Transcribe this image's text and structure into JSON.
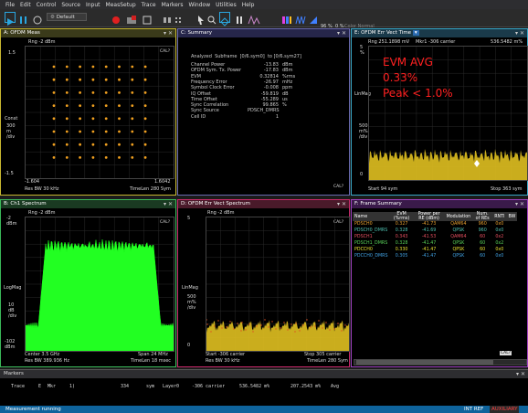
{
  "menu": [
    "File",
    "Edit",
    "Control",
    "Source",
    "Input",
    "MeasSetup",
    "Trace",
    "Markers",
    "Window",
    "Utilities",
    "Help"
  ],
  "toolbar": {
    "mode": "Default",
    "opacity": "96 %",
    "opacity_zero": "0 %",
    "color_mode": "Color Normal"
  },
  "panel_a": {
    "title": "A: OFDM Meas",
    "ref": "Rng -2 dBm",
    "cal": "CAL?",
    "y_top": "1.5",
    "y_mid": "Const",
    "y_scale": [
      "300",
      "m",
      "/div"
    ],
    "y_bottom": "-1.5",
    "x_left": "-1.604",
    "x_right": "1.6042",
    "footer_left": "Res BW 30 kHz",
    "footer_right": "TimeLen 280  Sym"
  },
  "panel_b": {
    "title": "B: Ch1 Spectrum",
    "ref": "Rng -2 dBm",
    "cal": "CAL?",
    "y_top": [
      "-2",
      "dBm"
    ],
    "y_mid": "LogMag",
    "y_scale": [
      "10",
      "dB",
      "/div"
    ],
    "y_bottom": [
      "-102",
      "dBm"
    ],
    "footer_left1": "Center 3.5 GHz",
    "footer_right1": "Span 24 MHz",
    "footer_left2": "Res BW 389.936 Hz",
    "footer_right2": "TimeLen 18 msec"
  },
  "panel_c": {
    "title": "C: Summary",
    "cal": "CAL?",
    "header": [
      "Analyzed",
      "Subframe",
      "[0/6.sym0]",
      "to",
      "[0/6.sym27]"
    ],
    "rows": [
      {
        "label": "Channel  Power",
        "value": "-13.83",
        "unit": "dBm"
      },
      {
        "label": "OFDM Sym. Tx. Power",
        "value": "-17.83",
        "unit": "dBm"
      },
      {
        "label": "EVM",
        "value": "0.32814",
        "unit": "%rms"
      },
      {
        "label": "Frequency  Error",
        "value": "-26.97",
        "unit": "mHz"
      },
      {
        "label": "Symbol  Clock  Error",
        "value": "-0.008",
        "unit": "ppm"
      },
      {
        "label": "IQ  Offset",
        "value": "-59.819",
        "unit": "dB"
      },
      {
        "label": "Time  Offset",
        "value": "-55.289",
        "unit": "us"
      },
      {
        "label": "Sync  Correlation",
        "value": "99.865",
        "unit": "%"
      },
      {
        "label": "Sync  Source",
        "value": "PDSCH_DMRS",
        "unit": ""
      },
      {
        "label": "Cell  ID",
        "value": "1",
        "unit": ""
      }
    ]
  },
  "panel_d": {
    "title": "D: OFDM Err Vect Spectrum",
    "ref": "Rng -2 dBm",
    "cal": "CAL?",
    "y_top": "5",
    "y_mid": "LinMag",
    "y_scale": [
      "500",
      "m%",
      "/div"
    ],
    "y_bottom": "0",
    "footer_left1": "Start -306  carrier",
    "footer_right1": "Stop 305  carrier",
    "footer_left2": "Res BW 30 kHz",
    "footer_right2": "TimeLen 280  Sym"
  },
  "panel_e": {
    "title": "E: OFDM Err Vect Time",
    "ref": "Rng 251.1898 mV",
    "marker": "Mkr1  -306 carrier",
    "marker_val": "536.5482 m%",
    "y_top": "5",
    "y_unit": "%",
    "y_mid": "LinMag",
    "y_scale": [
      "500",
      "m%",
      "/div"
    ],
    "y_bottom": "0",
    "footer_left": "Start 94  sym",
    "footer_right": "Stop 363  sym",
    "overlay": [
      "EVM AVG",
      "0.33%",
      "Peak < 1.0%"
    ]
  },
  "panel_f": {
    "title": "F: Frame Summary",
    "cal": "CAL?",
    "headers": [
      "Name",
      "EVM (%rms)",
      "Power per RE (dBm)",
      "Modulation",
      "Num. of REs",
      "RNTI",
      "BW"
    ],
    "rows": [
      {
        "name": "PDSCH0",
        "evm": "0.327",
        "power": "-41.73",
        "mod": "QAM64",
        "res": "960",
        "rnti": "0x0",
        "color": "#e8a030"
      },
      {
        "name": "PDSCH0_DMRS",
        "evm": "0.328",
        "power": "-41.69",
        "mod": "QPSK",
        "res": "960",
        "rnti": "0x0",
        "color": "#4ec0b0"
      },
      {
        "name": "PDSCH1",
        "evm": "0.343",
        "power": "-41.53",
        "mod": "QAM64",
        "res": "60",
        "rnti": "0x2",
        "color": "#e85060"
      },
      {
        "name": "PDSCH1_DMRS",
        "evm": "0.328",
        "power": "-41.47",
        "mod": "QPSK",
        "res": "60",
        "rnti": "0x2",
        "color": "#58d058"
      },
      {
        "name": "PDCCH0",
        "evm": "0.330",
        "power": "-41.47",
        "mod": "QPSK",
        "res": "60",
        "rnti": "0x0",
        "color": "#e8e030"
      },
      {
        "name": "PDCCH0_DMRS",
        "evm": "0.305",
        "power": "-41.47",
        "mod": "QPSK",
        "res": "60",
        "rnti": "0x0",
        "color": "#40a0e0"
      }
    ]
  },
  "markers": {
    "title": "Markers",
    "row": [
      "Trace",
      "E",
      "Mkr",
      "1)",
      "334",
      "sym",
      "Layer0",
      "-306 carrier",
      "536.5482 m%",
      "207.2543 m%",
      "Avg"
    ]
  },
  "status": {
    "left": "Measurement running",
    "right1": "INT REF",
    "right2": "AUXILIARY"
  },
  "colors": {
    "accent": "#0e639c",
    "constellation": "#f0a020",
    "spectrum": "#22ff22",
    "evm_trace": "#e0c020",
    "overlay_text": "#ff2020"
  }
}
